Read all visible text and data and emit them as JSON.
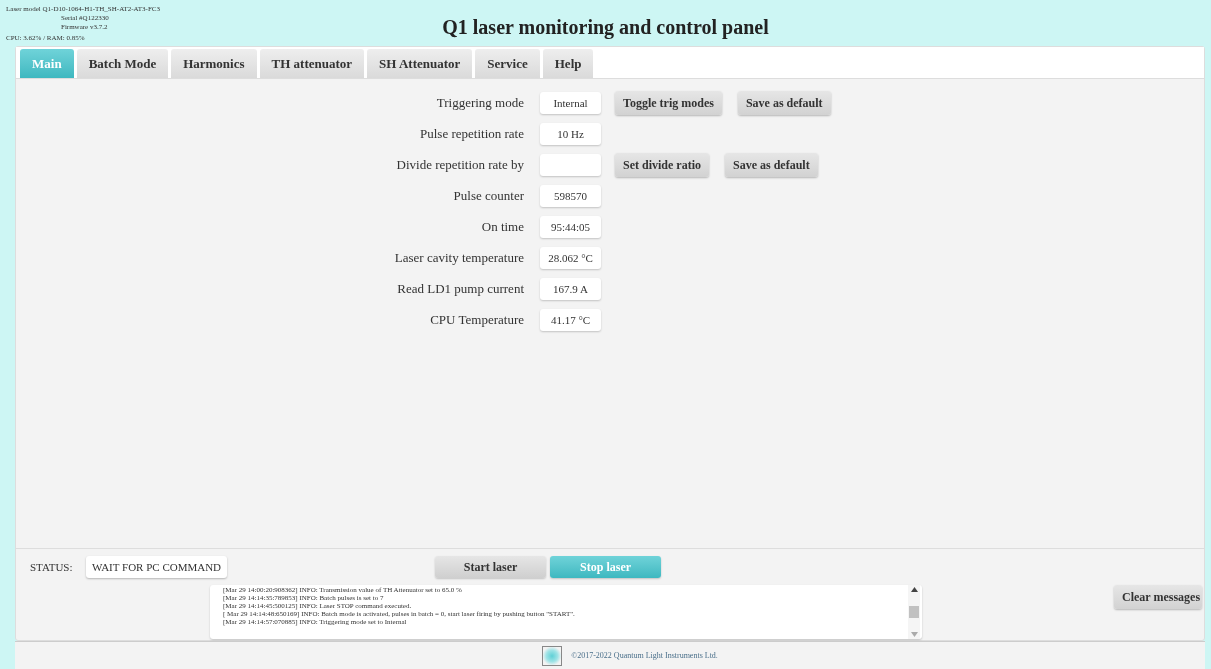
{
  "header": {
    "model": "Laser model Q1-D10-1064-H1-TH_SH-AT2-AT3-FC3",
    "serial": "Serial #Q122330",
    "firmware": "Firmware v3.7.2",
    "usage": "CPU: 3.62% / RAM: 0.85%",
    "title": "Q1 laser monitoring and control panel"
  },
  "tabs": [
    {
      "label": "Main",
      "selected": true
    },
    {
      "label": "Batch Mode",
      "selected": false
    },
    {
      "label": "Harmonics",
      "selected": false
    },
    {
      "label": "TH attenuator",
      "selected": false
    },
    {
      "label": "SH Attenuator",
      "selected": false
    },
    {
      "label": "Service",
      "selected": false
    },
    {
      "label": "Help",
      "selected": false
    }
  ],
  "rows": [
    {
      "kind": "display",
      "label": "Triggering mode",
      "value": "Internal",
      "buttons": [
        "Toggle trig modes",
        "Save as default"
      ]
    },
    {
      "kind": "display",
      "label": "Pulse repetition rate",
      "value": "10 Hz"
    },
    {
      "kind": "input",
      "label": "Divide repetition rate by",
      "buttons": [
        "Set divide ratio",
        "Save as default"
      ]
    },
    {
      "kind": "display",
      "label": "Pulse counter",
      "value": "598570"
    },
    {
      "kind": "display",
      "label": "On time",
      "value": "95:44:05"
    },
    {
      "kind": "display",
      "label": "Laser cavity temperature",
      "value": "28.062 °C"
    },
    {
      "kind": "display",
      "label": "Read LD1 pump current",
      "value": "167.9 A"
    },
    {
      "kind": "display",
      "label": "CPU Temperature",
      "value": "41.17 °C"
    }
  ],
  "status": {
    "label": "STATUS:",
    "value": "WAIT FOR PC COMMAND"
  },
  "laser_buttons": [
    {
      "label": "Start laser",
      "active": false
    },
    {
      "label": "Stop laser",
      "active": true
    }
  ],
  "messages": [
    "[Mar 29 14:00:20:908362] INFO: Transmission value of TH Attenuator set to 65.0 %",
    "[Mar 29 14:14:35:789853] INFO: Batch pulses is set to 7",
    "[Mar 29 14:14:45:500125] INFO: Laser STOP command executed.",
    "[ Mar 29 14:14:48:650169] INFO: Batch mode is activated, pulses in batch = 0, start laser firing by pushing button \"START\".",
    "[Mar 29 14:14:57:070885] INFO: Triggering mode set to Internal"
  ],
  "clear_button": "Clear messages",
  "footer": "©2017-2022 Quantum Light Instruments Ltd."
}
